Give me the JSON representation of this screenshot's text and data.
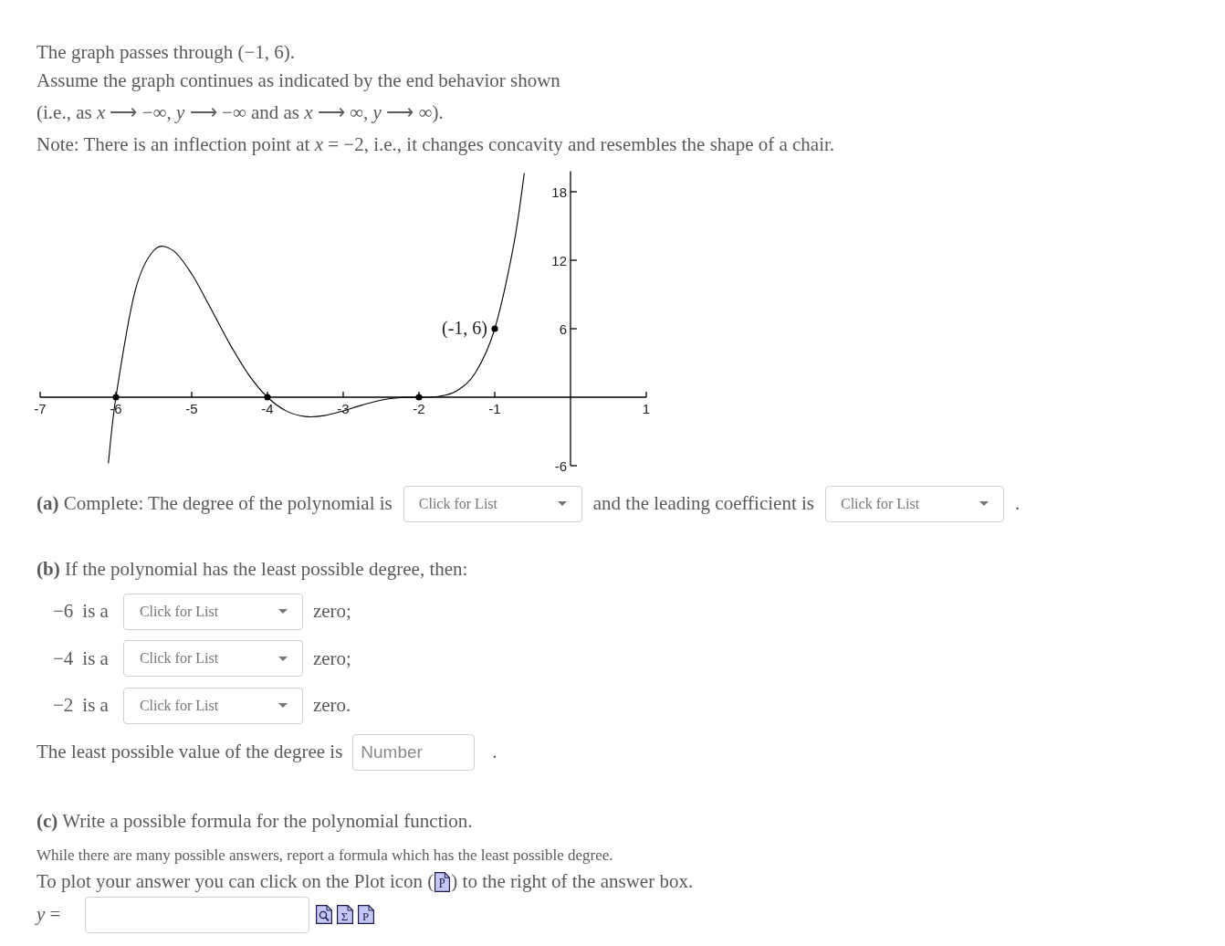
{
  "intro": [
    "The graph passes through (−1, 6).",
    "Assume the graph continues as indicated by the end behavior shown",
    "(i.e., as *x* ⟶ −∞, *y* ⟶ −∞ and as *x* ⟶ ∞, *y* ⟶ ∞).",
    "Note: There is an inflection point at *x* = −2, i.e., it changes concavity and resembles the shape of a chair."
  ],
  "graph": {
    "chart_data": {
      "type": "line",
      "x": [
        -6.1,
        -6,
        -5.75,
        -5.5,
        -5.25,
        -5,
        -4.75,
        -4.5,
        -4.25,
        -4,
        -3.75,
        -3.5,
        -3.25,
        -3,
        -2.75,
        -2.5,
        -2.25,
        -2,
        -1.75,
        -1.5,
        -1.25,
        -1,
        -0.75,
        -0.61
      ],
      "series": [
        {
          "values": [
            -5.79,
            0,
            9.23,
            12.86,
            12.87,
            10.8,
            7.8,
            4.69,
            1.99,
            0,
            -1.21,
            -1.69,
            -1.61,
            -1.2,
            -0.69,
            -0.26,
            -0.04,
            0,
            0.06,
            0.56,
            2.2,
            6,
            13.33,
            19.63
          ]
        }
      ],
      "xlim": [
        -7,
        1
      ],
      "ylim": [
        -6,
        19.8
      ],
      "xticks": [
        -7,
        -6,
        -5,
        -4,
        -3,
        -2,
        -1,
        1
      ],
      "yticks": [
        -6,
        6,
        12,
        18
      ],
      "annotations": [
        {
          "x": -1,
          "y": 6,
          "text": "(-1, 6)"
        }
      ]
    }
  },
  "part_a": {
    "segments": [
      {
        "kind": "text",
        "text": "**(a)** Complete: The degree of the polynomial is"
      },
      {
        "kind": "select",
        "placeholder": "Click for List"
      },
      {
        "kind": "text",
        "text": "and the leading coefficient is"
      },
      {
        "kind": "select",
        "placeholder": "Click for List"
      },
      {
        "kind": "text",
        "text": "."
      }
    ]
  },
  "part_b": {
    "prompt": "**(b)** If the polynomial has the least possible degree, then:",
    "zeros": [
      {
        "value": "−6",
        "text": "is a",
        "placeholder": "Click for List",
        "suffix": "zero;"
      },
      {
        "value": "−4",
        "text": "is a",
        "placeholder": "Click for List",
        "suffix": "zero;"
      },
      {
        "value": "−2",
        "text": "is a",
        "placeholder": "Click for List",
        "suffix": "zero."
      }
    ],
    "degree_question": {
      "text": "The least possible value of the degree is",
      "placeholder": "Number",
      "suffix": "."
    }
  },
  "part_c": {
    "prompt": "**(c)** Write a possible formula for the polynomial function.",
    "hint": "While there are many possible answers, report a formula which has the least possible degree.",
    "plot_note": {
      "before": "To plot your answer you can click on the Plot icon (",
      "icon": {
        "kind": "plot",
        "glyph": "P"
      },
      "after": ") to the right of the answer box."
    },
    "answer": {
      "label": "*y* =",
      "tools": [
        {
          "kind": "preview"
        },
        {
          "kind": "sum",
          "glyph": "Σ"
        },
        {
          "kind": "plot",
          "glyph": "P"
        }
      ]
    }
  }
}
